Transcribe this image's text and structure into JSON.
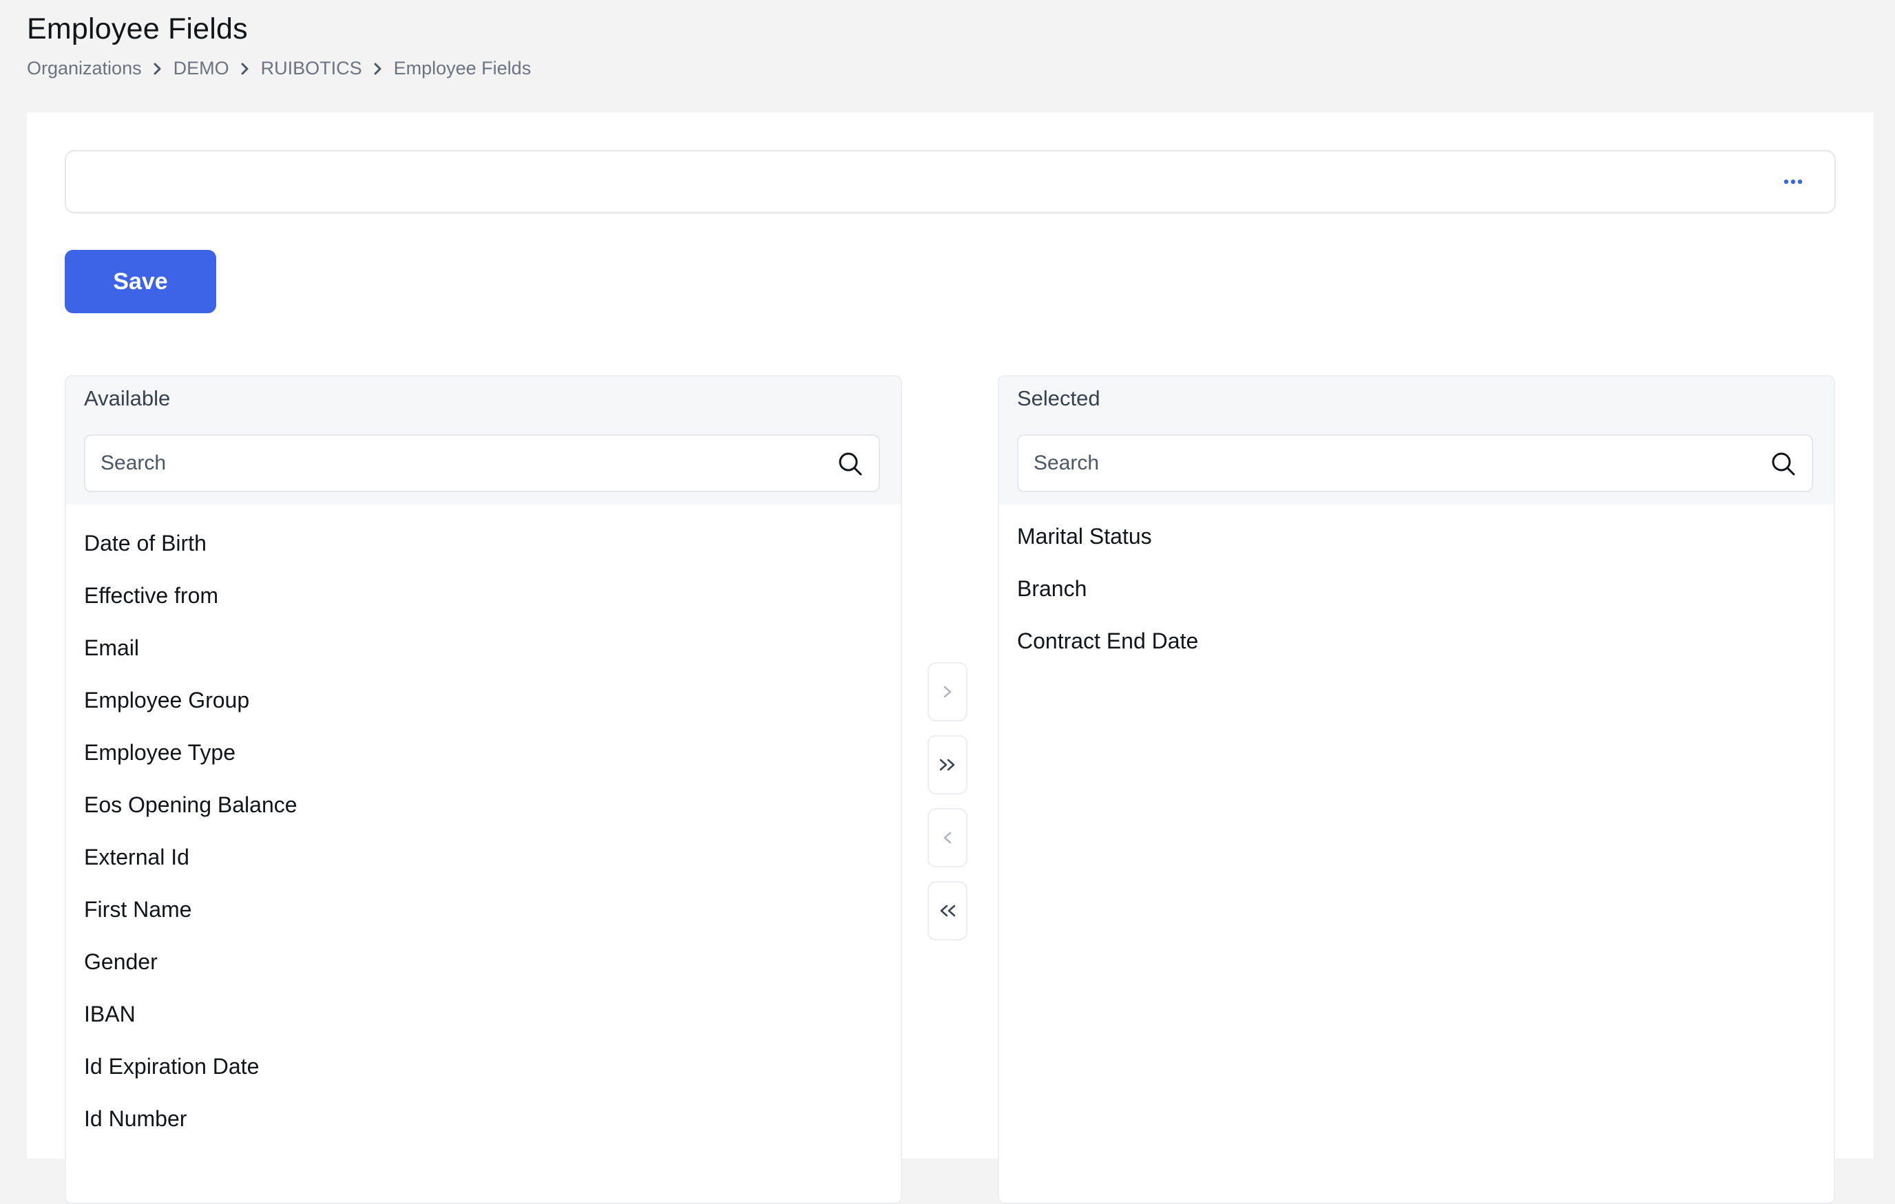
{
  "page": {
    "title": "Employee Fields"
  },
  "breadcrumb": [
    "Organizations",
    "DEMO",
    "RUIBOTICS",
    "Employee Fields"
  ],
  "toolbar": {
    "more_icon": "ellipsis-icon",
    "save_label": "Save"
  },
  "available": {
    "title": "Available",
    "search_placeholder": "Search",
    "items": [
      "Date of Birth",
      "Effective from",
      "Email",
      "Employee Group",
      "Employee Type",
      "Eos Opening Balance",
      "External Id",
      "First Name",
      "Gender",
      "IBAN",
      "Id Expiration Date",
      "Id Number"
    ]
  },
  "selected": {
    "title": "Selected",
    "search_placeholder": "Search",
    "items": [
      "Marital Status",
      "Branch",
      "Contract End Date"
    ]
  },
  "transfer": {
    "move_right_icon": "chevron-right-icon",
    "move_all_right_icon": "double-chevron-right-icon",
    "move_left_icon": "chevron-left-icon",
    "move_all_left_icon": "double-chevron-left-icon"
  },
  "colors": {
    "primary": "#3d63e6",
    "background": "#f3f3f4",
    "panel_header": "#f6f7f9"
  }
}
